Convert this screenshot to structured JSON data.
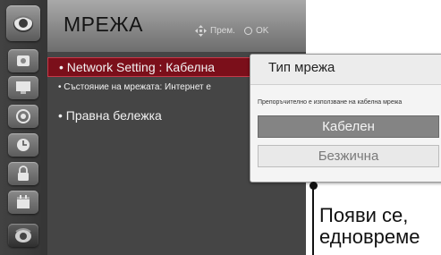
{
  "header": {
    "title": "МРЕЖА",
    "move_hint": "Прем.",
    "ok_hint": "OK"
  },
  "sidebar": {
    "items": [
      {
        "icon": "tv-globe-icon"
      },
      {
        "icon": "picture-icon"
      },
      {
        "icon": "monitor-icon"
      },
      {
        "icon": "speaker-icon"
      },
      {
        "icon": "clock-icon"
      },
      {
        "icon": "lock-icon"
      },
      {
        "icon": "calendar-icon"
      },
      {
        "icon": "network-icon",
        "active": true
      }
    ]
  },
  "menu": {
    "items": [
      {
        "label": "• Network Setting  : Кабелна",
        "selected": true
      },
      {
        "label": "• Състояние на мрежата: Интернет е"
      },
      {
        "label": "• Правна бележка"
      }
    ]
  },
  "popup": {
    "title": "Тип мрежа",
    "note": "Препоръчително е използване на кабелна мрежа",
    "options": [
      {
        "label": "Кабелен",
        "selected": true
      },
      {
        "label": "Безжична",
        "selected": false
      }
    ]
  },
  "callout": {
    "line1": "Появи се,",
    "line2": "едновреме"
  }
}
